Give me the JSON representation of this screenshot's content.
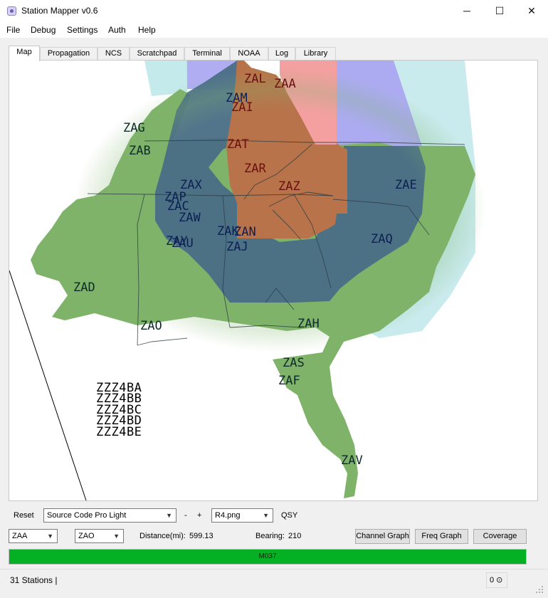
{
  "window": {
    "title": "Station Mapper v0.6",
    "minimize": "─",
    "maximize": "☐",
    "close": "✕"
  },
  "menu": [
    "File",
    "Debug",
    "Settings",
    "Auth",
    "Help"
  ],
  "tabs": [
    "Map",
    "Propagation",
    "NCS",
    "Scratchpad",
    "Terminal",
    "NOAA",
    "Log",
    "Library"
  ],
  "active_tab": "Map",
  "map": {
    "dark_labels": [
      "ZAG",
      "ZAB",
      "ZAX",
      "ZAP",
      "ZAC",
      "ZAW",
      "ZAY",
      "ZAU",
      "ZAK",
      "ZAN",
      "ZAJ",
      "ZAE",
      "ZAQ",
      "ZAD",
      "ZAO",
      "ZAH",
      "ZAS",
      "ZAF",
      "ZAV",
      "ZAM"
    ],
    "red_labels": [
      "ZAL",
      "ZAA",
      "ZAI",
      "ZAT",
      "ZAR",
      "ZAZ"
    ],
    "callsigns": [
      "ZZZ4BA",
      "ZZZ4BB",
      "ZZZ4BC",
      "ZZZ4BD",
      "ZZZ4BE"
    ],
    "colors": {
      "land_green": "#7fb36a",
      "dark_overlay": "#4a6e86",
      "brown_zone": "#b8734a",
      "pink_zone": "#f4a0a0",
      "lavender": "#a9a4f2",
      "cyan": "#bfe8ea"
    }
  },
  "controls": {
    "reset_label": "Reset",
    "font_select": "Source Code Pro Light",
    "minus": "-",
    "plus": "+",
    "image_select": "R4.png",
    "qsy_label": "QSY",
    "from_station": "ZAA",
    "to_station": "ZAO",
    "distance_label": "Distance(mi):",
    "distance_value": "599.13",
    "bearing_label": "Bearing:",
    "bearing_value": "210",
    "channel_graph": "Channel Graph",
    "freq_graph": "Freq Graph",
    "coverage": "Coverage"
  },
  "progress": {
    "text": "M037",
    "fraction": 1.0
  },
  "status": {
    "text": "31 Stations |",
    "counter": "0 ⊙"
  }
}
